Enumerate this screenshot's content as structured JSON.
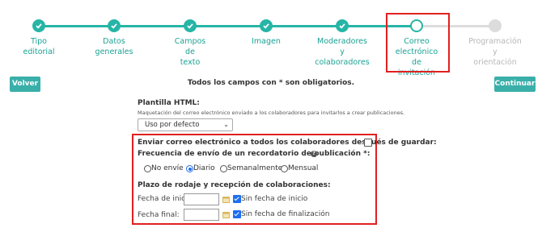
{
  "steps": [
    {
      "label": "Tipo editorial",
      "state": "done"
    },
    {
      "label": "Datos generales",
      "state": "done"
    },
    {
      "label": "Campos de texto",
      "state": "done"
    },
    {
      "label": "Imagen",
      "state": "done"
    },
    {
      "label": "Moderadores y\ncolaboradores",
      "state": "done"
    },
    {
      "label": "Correo\nelectrónico de\ninvitación",
      "state": "current"
    },
    {
      "label": "Programación y\norientación",
      "state": "todo"
    }
  ],
  "buttons": {
    "back": "Volver",
    "continue": "Continuar"
  },
  "notice": "Todos los campos con * son obligatorios.",
  "template": {
    "label": "Plantilla HTML:",
    "help": "Maquetación del correo electrónico enviado a los colaboradores para invitarlos a crear publicaciones.",
    "selected": "Uso por defecto"
  },
  "send_all": {
    "label": "Enviar correo electrónico a todos los colaboradores después de guardar:",
    "checked": false
  },
  "frequency": {
    "label": "Frecuencia de envío de un recordatorio de publicación *:",
    "options": [
      "No envíe",
      "Diario",
      "Semanalmente",
      "Mensual"
    ],
    "selected": "Diario"
  },
  "deadline": {
    "label": "Plazo de rodaje y recepción de colaboraciones:",
    "start_label": "Fecha de inicio:",
    "end_label": "Fecha final:",
    "start_value": "",
    "end_value": "",
    "no_start_label": "Sin fecha de inicio",
    "no_end_label": "Sin fecha de finalización",
    "no_start_checked": true,
    "no_end_checked": true
  },
  "colors": {
    "accent": "#26b5a6",
    "highlight": "#e02020",
    "radio": "#1e6ff0"
  }
}
